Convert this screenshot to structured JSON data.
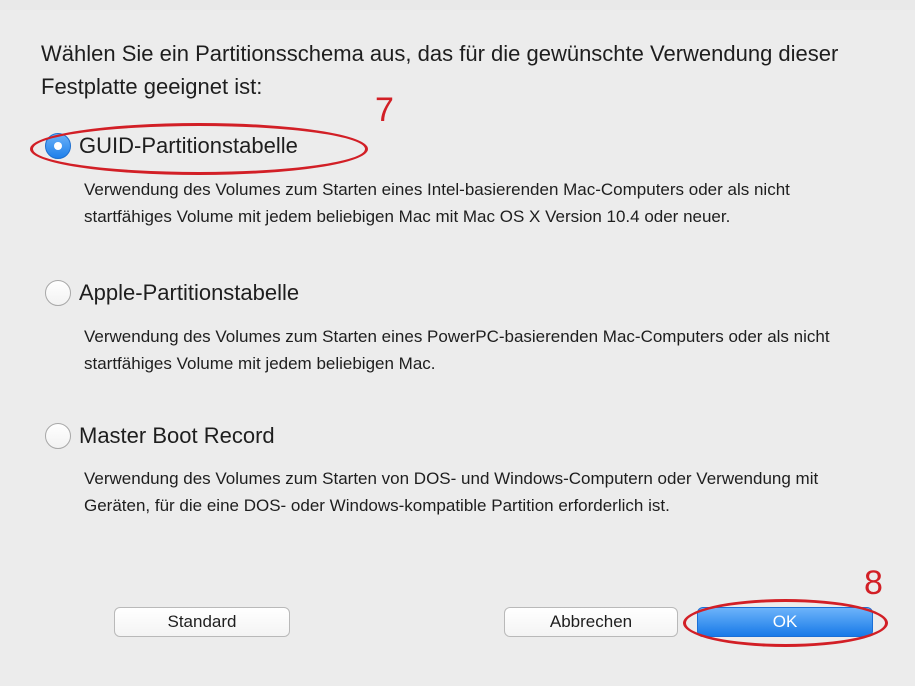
{
  "dialog": {
    "prompt": "Wählen Sie ein Partitionsschema aus, das für die gewünschte Verwendung dieser Festplatte geeignet ist:",
    "options": [
      {
        "label": "GUID-Partitionstabelle",
        "selected": true,
        "description": "Verwendung des Volumes zum Starten eines Intel-basierenden Mac-Computers oder als nicht startfähiges Volume mit jedem beliebigen Mac mit Mac OS X Version 10.4 oder neuer."
      },
      {
        "label": "Apple-Partitionstabelle",
        "selected": false,
        "description": "Verwendung des Volumes zum Starten eines PowerPC-basierenden Mac-Computers oder als nicht startfähiges Volume mit jedem beliebigen Mac."
      },
      {
        "label": "Master Boot Record",
        "selected": false,
        "description": "Verwendung des Volumes zum Starten von DOS- und Windows-Computern oder Verwendung mit Geräten, für die eine DOS- oder Windows-kompatible Partition erforderlich ist."
      }
    ],
    "buttons": {
      "standard": "Standard",
      "cancel": "Abbrechen",
      "ok": "OK"
    }
  },
  "annotations": {
    "step_option": "7",
    "step_ok": "8",
    "color": "#d21f26"
  },
  "colors": {
    "accent": "#1f80ea",
    "background": "#ececec"
  }
}
